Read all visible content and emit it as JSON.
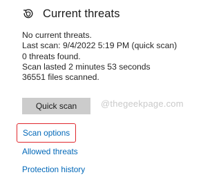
{
  "section": {
    "title": "Current threats",
    "icon": "shield-refresh-icon"
  },
  "info": {
    "line1": "No current threats.",
    "line2": "Last scan: 9/4/2022 5:19 PM (quick scan)",
    "line3": "0 threats found.",
    "line4": "Scan lasted 2 minutes 53 seconds",
    "line5": "36551 files scanned."
  },
  "actions": {
    "quick_scan_label": "Quick scan"
  },
  "watermark": "@thegeekpage.com",
  "links": {
    "scan_options": "Scan options",
    "allowed_threats": "Allowed threats",
    "protection_history": "Protection history"
  },
  "colors": {
    "link": "#0067b8",
    "highlight": "#e0262b",
    "button_bg": "#cccccc"
  }
}
